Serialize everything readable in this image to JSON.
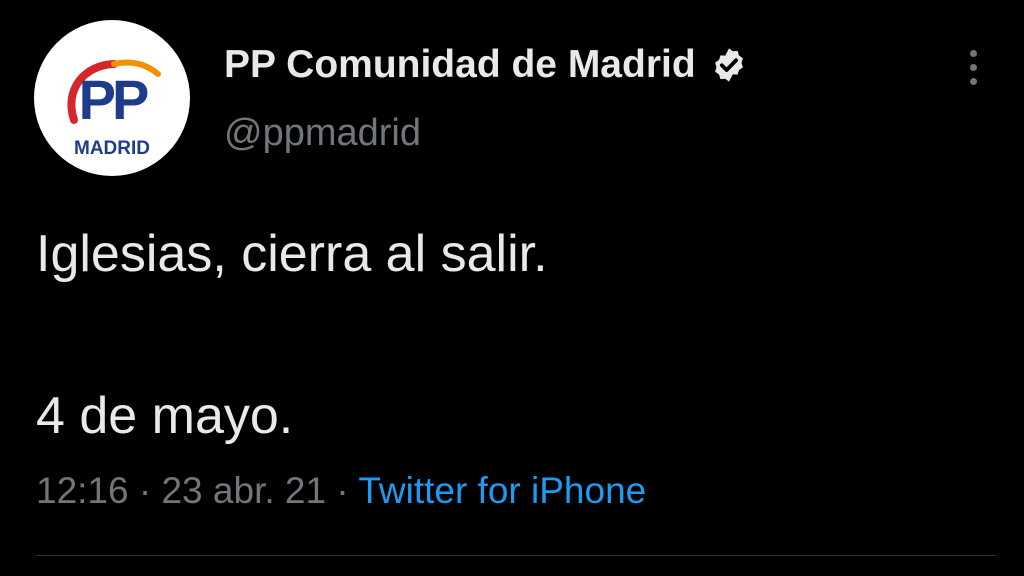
{
  "author": {
    "display_name": "PP Comunidad de Madrid",
    "handle": "@ppmadrid",
    "verified": true,
    "avatar_logo": {
      "mark": "PP",
      "caption": "MADRID"
    }
  },
  "tweet": {
    "line1": "Iglesias, cierra al salir.",
    "line2": "4 de mayo."
  },
  "meta": {
    "time": "12:16",
    "separator": "·",
    "date": "23 abr. 21",
    "source": "Twitter for iPhone"
  },
  "icons": {
    "verified": "verified-badge-icon",
    "more": "more-options-icon"
  },
  "colors": {
    "background": "#000000",
    "primary_text": "#e7e9ea",
    "secondary_text": "#71767b",
    "link": "#1d9bf0",
    "logo_blue": "#1f3c8c",
    "logo_red": "#d5262b",
    "logo_orange": "#f39200"
  }
}
